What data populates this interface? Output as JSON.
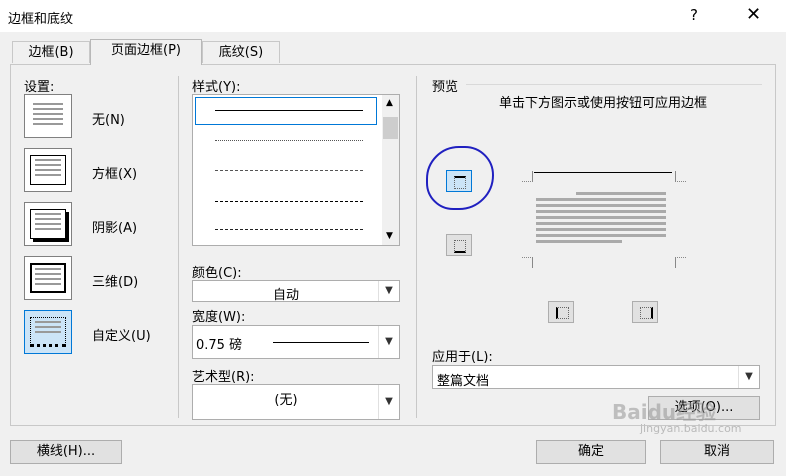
{
  "window": {
    "title": "边框和底纹",
    "help": "?",
    "close": "✕"
  },
  "tabs": [
    {
      "label": "边框(B)"
    },
    {
      "label": "页面边框(P)"
    },
    {
      "label": "底纹(S)"
    }
  ],
  "settings": {
    "heading": "设置:",
    "items": [
      {
        "label": "无(N)"
      },
      {
        "label": "方框(X)"
      },
      {
        "label": "阴影(A)"
      },
      {
        "label": "三维(D)"
      },
      {
        "label": "自定义(U)"
      }
    ]
  },
  "style": {
    "heading": "样式(Y):",
    "color_label": "颜色(C):",
    "color_value": "自动",
    "width_label": "宽度(W):",
    "width_value": "0.75 磅",
    "art_label": "艺术型(R):",
    "art_value": "(无)"
  },
  "preview": {
    "heading": "预览",
    "hint": "单击下方图示或使用按钮可应用边框",
    "apply_label": "应用于(L):",
    "apply_value": "整篇文档",
    "options_button": "选项(O)..."
  },
  "footer": {
    "hline_button": "横线(H)...",
    "ok_button": "确定",
    "cancel_button": "取消"
  },
  "watermark": {
    "text": "Baidu经验",
    "url": "jingyan.baidu.com"
  }
}
